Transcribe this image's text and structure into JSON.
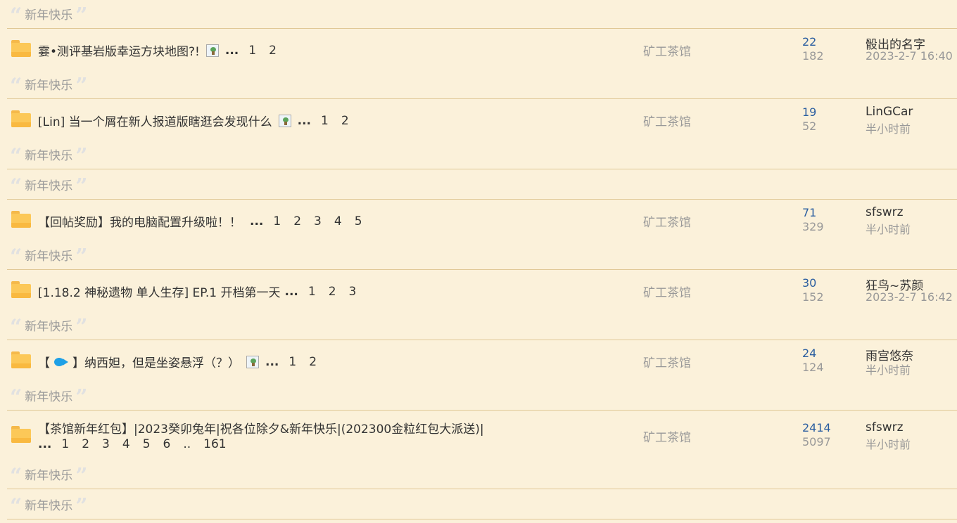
{
  "quote_text": "新年快乐",
  "forum_name": "矿工茶馆",
  "threads": [
    {
      "title": "霎•测评基岩版幸运方块地图?!",
      "has_image": true,
      "ellipsis": "...",
      "pages": [
        "1",
        "2"
      ],
      "replies": "22",
      "views": "182",
      "last_user": "骰出的名字",
      "last_time": "2023-2-7 16:40"
    },
    {
      "title": "[Lin] 当一个屑在新人报道版瞎逛会发现什么",
      "has_image": true,
      "ellipsis": "...",
      "pages": [
        "1",
        "2"
      ],
      "replies": "19",
      "views": "52",
      "last_user": "LinGCar",
      "last_time": "半小时前"
    },
    {
      "title": "【回帖奖励】我的电脑配置升级啦！！",
      "has_image": false,
      "ellipsis": "...",
      "pages": [
        "1",
        "2",
        "3",
        "4",
        "5"
      ],
      "replies": "71",
      "views": "329",
      "last_user": "sfswrz",
      "last_time": "半小时前"
    },
    {
      "title": "[1.18.2 神秘遗物 单人生存] EP.1 开档第一天",
      "has_image": false,
      "ellipsis": "...",
      "pages": [
        "1",
        "2",
        "3"
      ],
      "replies": "30",
      "views": "152",
      "last_user": "狂鸟~苏颜",
      "last_time": "2023-2-7 16:42"
    },
    {
      "title_prefix": "【",
      "title_suffix": "】纳西妲，但是坐姿悬浮（？）",
      "has_image": true,
      "ellipsis": "...",
      "pages": [
        "1",
        "2"
      ],
      "replies": "24",
      "views": "124",
      "last_user": "雨宫悠奈",
      "last_time": "半小时前"
    },
    {
      "title": "【茶馆新年红包】|2023癸卯兔年|祝各位除夕&新年快乐|(202300金粒红包大派送)|",
      "ellipsis": "...",
      "pages": [
        "1",
        "2",
        "3",
        "4",
        "5",
        "6"
      ],
      "pages_gap": "..",
      "last_page": "161",
      "replies": "2414",
      "views": "5097",
      "last_user": "sfswrz",
      "last_time": "半小时前"
    }
  ]
}
